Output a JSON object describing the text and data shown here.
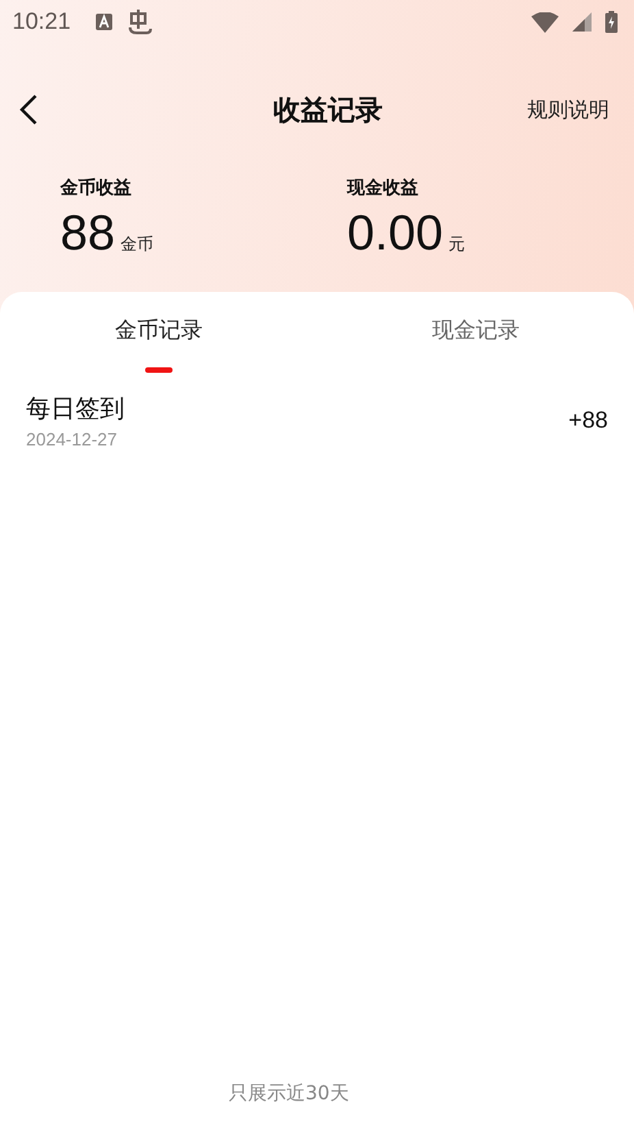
{
  "status_bar": {
    "time": "10:21"
  },
  "header": {
    "title": "收益记录",
    "action": "规则说明"
  },
  "summary": [
    {
      "label": "金币收益",
      "value": "88",
      "unit": "金币"
    },
    {
      "label": "现金收益",
      "value": "0.00",
      "unit": "元"
    }
  ],
  "tabs": [
    {
      "label": "金币记录",
      "selected": true
    },
    {
      "label": "现金记录",
      "selected": false
    }
  ],
  "records": [
    {
      "title": "每日签到",
      "date": "2024-12-27",
      "amount": "+88"
    }
  ],
  "footer": "只展示近30天"
}
